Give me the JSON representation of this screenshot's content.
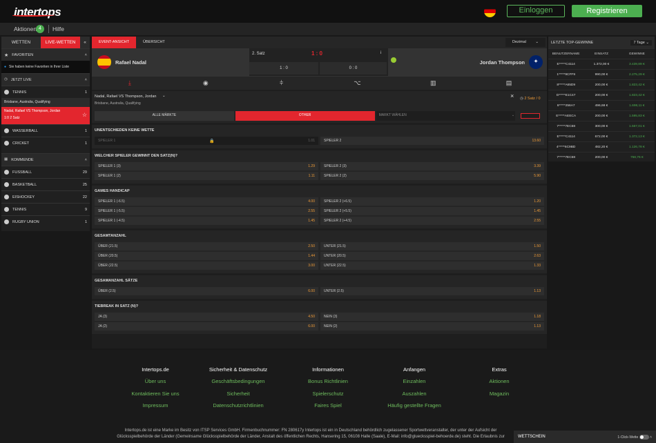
{
  "header": {
    "logo": "intertops",
    "login": "Einloggen",
    "register": "Registrieren"
  },
  "subbar": {
    "aktionen": "Aktionen",
    "aktionen_count": "4",
    "hilfe": "Hilfe"
  },
  "left": {
    "tab_wetten": "WETTEN",
    "tab_live": "LIVE-WETTEN",
    "favoriten": "FAVORITEN",
    "fav_msg": "Sie haben keine Favoriten in Ihrer Liste",
    "jetzt_live": "JETZT LIVE",
    "live_items": [
      {
        "label": "TENNIS",
        "count": "1"
      }
    ],
    "breadcrumb": "Brisbane, Australia, Qualifying",
    "match": "Nadal, Rafael VS Thompson, Jordan",
    "match_score": "1:0 2 Satz",
    "live_more": [
      {
        "label": "WASSERBALL",
        "count": "1"
      },
      {
        "label": "CRICKET",
        "count": "1"
      }
    ],
    "kommende": "KOMMENDE",
    "upcoming": [
      {
        "label": "FUSSBALL",
        "count": "29"
      },
      {
        "label": "BASKETBALL",
        "count": "25"
      },
      {
        "label": "EISHOCKEY",
        "count": "22"
      },
      {
        "label": "TENNIS",
        "count": "9"
      },
      {
        "label": "RUGBY UNION",
        "count": "1"
      }
    ]
  },
  "event": {
    "tab_event": "EVENT-ANSICHT",
    "tab_overview": "ÜBERSICHT",
    "odds_format": "Dezimal",
    "player1": "Rafael Nadal",
    "player2": "Jordan Thompson",
    "set_label": "2. Satz",
    "score": "1 : 0",
    "set_score": "1 : 0",
    "game_score": "0 : 0",
    "match_title": "Nadal, Rafael VS Thompson, Jordan",
    "match_sub": "Brisbane, Australia, Qualifying",
    "satz_info": "2 Satz / 0",
    "filter_all": "ALLE MÄRKTE",
    "filter_other": "OTHER",
    "filter_select": "MARKT WÄHLEN"
  },
  "markets": [
    {
      "title": "UNENTSCHIEDEN KEINE WETTE",
      "rows": [
        [
          {
            "l": "SPIELER 1",
            "o": "1.01",
            "locked": true
          },
          {
            "l": "SPIELER 2",
            "o": "13.60"
          }
        ]
      ]
    },
    {
      "title": "WELCHER SPIELER GEWINNT DEN SATZ(N)?",
      "rows": [
        [
          {
            "l": "SPIELER 1 (3)",
            "o": "1.29"
          },
          {
            "l": "SPIELER 2 (3)",
            "o": "3.39"
          }
        ],
        [
          {
            "l": "SPIELER 1 (2)",
            "o": "1.11"
          },
          {
            "l": "SPIELER 2 (2)",
            "o": "5.90"
          }
        ]
      ]
    },
    {
      "title": "GAMES HANDICAP",
      "rows": [
        [
          {
            "l": "SPIELER 1 (-6.5)",
            "o": "4.00"
          },
          {
            "l": "SPIELER 2 (+6.5)",
            "o": "1.20"
          }
        ],
        [
          {
            "l": "SPIELER 1 (-5.5)",
            "o": "2.55"
          },
          {
            "l": "SPIELER 2 (+5.5)",
            "o": "1.45"
          }
        ],
        [
          {
            "l": "SPIELER 1 (-4.5)",
            "o": "1.45"
          },
          {
            "l": "SPIELER 2 (+4.5)",
            "o": "2.55"
          }
        ]
      ]
    },
    {
      "title": "GESAMTANZAHL",
      "rows": [
        [
          {
            "l": "ÜBER (21.5)",
            "o": "2.50"
          },
          {
            "l": "UNTER (21.5)",
            "o": "1.50"
          }
        ],
        [
          {
            "l": "ÜBER (20.5)",
            "o": "1.44"
          },
          {
            "l": "UNTER (20.5)",
            "o": "2.63"
          }
        ],
        [
          {
            "l": "ÜBER (22.5)",
            "o": "3.00"
          },
          {
            "l": "UNTER (22.5)",
            "o": "1.33"
          }
        ]
      ]
    },
    {
      "title": "GESAMANZAHL SÄTZE",
      "rows": [
        [
          {
            "l": "ÜBER (2.5)",
            "o": "6.00"
          },
          {
            "l": "UNTER (2.5)",
            "o": "1.13"
          }
        ]
      ]
    },
    {
      "title": "TIEBREAK IN SATZ (N)?",
      "rows": [
        [
          {
            "l": "JA (3)",
            "o": "4.50"
          },
          {
            "l": "NEIN (3)",
            "o": "1.18"
          }
        ],
        [
          {
            "l": "JA (2)",
            "o": "6.00"
          },
          {
            "l": "NEIN (2)",
            "o": "1.13"
          }
        ]
      ]
    }
  ],
  "right": {
    "title": "LETZTE TOP-GEWINNE",
    "period": "7 Tage",
    "cols": [
      "BENUTZERNAME",
      "EINSATZ",
      "GEWINNE"
    ],
    "rows": [
      [
        "E*****C4114",
        "1.372,00 €",
        "3.439,89 €"
      ],
      [
        "1*****9CFF9",
        "990,00 €",
        "2.275,29 €"
      ],
      [
        "8*****A65D9",
        "200,00 €",
        "1.823,42 €"
      ],
      [
        "D*****E1C47",
        "200,00 €",
        "1.823,42 €"
      ],
      [
        "6*****256A7",
        "496,68 €",
        "1.698,11 €"
      ],
      [
        "E*****AEECA",
        "200,00 €",
        "1.595,83 €"
      ],
      [
        "7*****7EC68",
        "300,00 €",
        "1.567,01 €"
      ],
      [
        "E*****C4114",
        "672,00 €",
        "1.372,13 €"
      ],
      [
        "4*****6C9BD",
        "482,20 €",
        "1.126,78 €"
      ],
      [
        "7*****7EC68",
        "200,00 €",
        "758,76 €"
      ]
    ]
  },
  "footer": {
    "cols": [
      {
        "t": "Intertops.de",
        "l": [
          "Über uns",
          "Kontaktieren Sie uns",
          "Impressum"
        ]
      },
      {
        "t": "Sicherheit & Datenschutz",
        "l": [
          "Geschäftsbedingungen",
          "Sicherheit",
          "Datenschutzrichtlinien"
        ]
      },
      {
        "t": "Informationen",
        "l": [
          "Bonus Richtlinien",
          "Spielerschutz",
          "Faires Spiel"
        ]
      },
      {
        "t": "Anfangen",
        "l": [
          "Einzahlen",
          "Auszahlen",
          "Häufig gestellte Fragen"
        ]
      },
      {
        "t": "Extras",
        "l": [
          "Aktionen",
          "Magazin"
        ]
      }
    ],
    "legal1": "Intertops.de ist eine Marke im Besitz von ITSP Services GmbH. Firmenbuchnummer: FN 280617y Intertops ist ein in Deutschland behördlich zugelassener Sportwettveranstalter, der unter der Aufsicht der",
    "legal2": "Glücksspielbehörde der Länder (Gemeinsame Glücksspielbehörde der Länder, Anstalt des öffentlichen Rechts, Hansering 15, 06108 Halle (Saale), E-Mail: info@gluecksspiel-behoerde.de) steht. Die Erlaubnis zur"
  },
  "wettschein": {
    "label": "WETTSCHEIN",
    "oneclick": "1-Click-Wette"
  }
}
